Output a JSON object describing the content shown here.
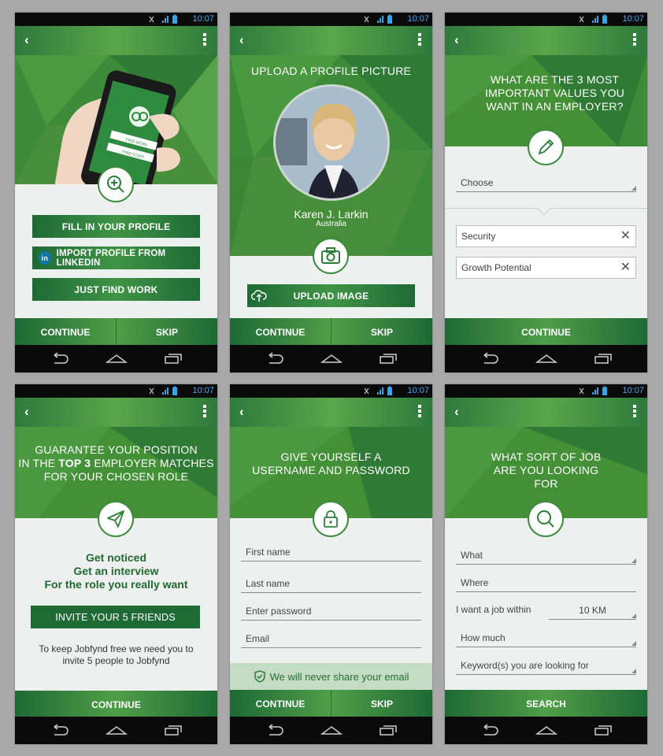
{
  "status": {
    "time": "10:07"
  },
  "s1": {
    "phone_find_work": "FIND WORK",
    "phone_find_staff": "FIND STAFF",
    "btn_fill_profile": "FILL IN YOUR PROFILE",
    "linkedin_badge": "in",
    "btn_import_linkedin": "IMPORT PROFILE FROM LINKEDIN",
    "btn_just_find_work": "JUST FIND WORK",
    "continue": "CONTINUE",
    "skip": "SKIP"
  },
  "s2": {
    "title": "UPLOAD A PROFILE PICTURE",
    "name": "Karen J. Larkin",
    "country": "Australia",
    "btn_upload": "UPLOAD IMAGE",
    "continue": "CONTINUE",
    "skip": "SKIP"
  },
  "s3": {
    "title": "WHAT ARE THE 3 MOST IMPORTANT VALUES YOU WANT IN AN EMPLOYER?",
    "choose": "Choose",
    "tags": [
      "Security",
      "Growth Potential"
    ],
    "continue": "CONTINUE"
  },
  "s4": {
    "title_line1": "GUARANTEE YOUR POSITION",
    "title_line2_pre": "IN THE ",
    "title_line2_bold": "TOP 3",
    "title_line2_post": " EMPLOYER MATCHES",
    "title_line3": "FOR YOUR CHOSEN ROLE",
    "line1": "Get noticed",
    "line2": "Get an interview",
    "line3": "For the role you really want",
    "btn_invite": "INVITE YOUR 5 FRIENDS",
    "note": "To keep Jobfynd free we need you to invite 5 people to Jobfynd",
    "continue": "CONTINUE"
  },
  "s5": {
    "title": "GIVE YOURSELF A USERNAME AND PASSWORD",
    "first_name": "First name",
    "last_name": "Last name",
    "password": "Enter password",
    "email": "Email",
    "privacy": "We will never share your email",
    "continue": "CONTINUE",
    "skip": "SKIP"
  },
  "s6": {
    "title": "WHAT SORT OF JOB ARE YOU LOOKING FOR",
    "what": "What",
    "where": "Where",
    "within_label": "I want a job within",
    "within_value": "10 KM",
    "how_much": "How much",
    "keywords": "Keyword(s) you are looking for",
    "search": "SEARCH"
  },
  "colors": {
    "primary": "#2e7d3a",
    "accent": "#5aa64a",
    "text_green": "#1e6a30"
  }
}
